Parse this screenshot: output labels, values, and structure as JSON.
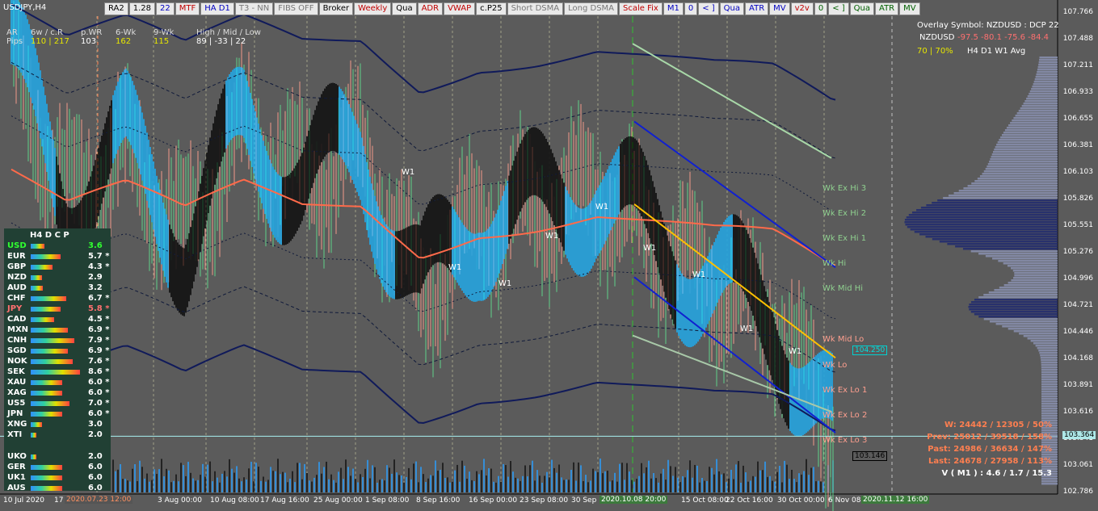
{
  "symbol": "USDJPY,H4",
  "toolbar": [
    "RA2",
    "1.28",
    "22",
    "MTF",
    "HA D1",
    "T3 - NN",
    "FIBS OFF",
    "Broker",
    "Weekly",
    "Qua",
    "ADR",
    "VWAP",
    "c.P25",
    "Short DSMA",
    "Long DSMA",
    "Scale Fix",
    "M1",
    "0",
    "< ]",
    "Qua",
    "ATR",
    "MV",
    "v2v",
    "0",
    "< ]",
    "Qua",
    "ATR",
    "MV"
  ],
  "toolbar_colors": [
    "#000",
    "#000",
    "#0000c0",
    "#c00000",
    "#0000c0",
    "#777",
    "#777",
    "#000",
    "#c00000",
    "#000",
    "#c00000",
    "#c00000",
    "#000",
    "#777",
    "#777",
    "#c00000",
    "#0000c0",
    "#0000c0",
    "#0000c0",
    "#0000c0",
    "#0000c0",
    "#0000c0",
    "#c00000",
    "#006000",
    "#006000",
    "#006000",
    "#006000",
    "#006000"
  ],
  "header": {
    "ar": "AR",
    "pips": "Pips",
    "c1": "6w / c.R",
    "c2": "p.WR",
    "c3": "6-Wk",
    "c4": "9-Wk",
    "c5": "High / Mid / Low",
    "v1": "110 | 217",
    "v2": "103",
    "v3": "162",
    "v4": "115",
    "v5": "89  |  -33  |  22"
  },
  "overlay": {
    "line1": "Overlay Symbol: NZDUSD : DCP 22",
    "sym": "NZDUSD",
    "vals": "-97.5  -80.1  -75.6  -84.4",
    "pct": "70 | 70%",
    "tfs": "H4    D1    W1    Avg"
  },
  "panel": {
    "header": "H4   D C P",
    "rows": [
      {
        "name": "USD",
        "value": "3.6",
        "bar": 0.25,
        "color": "#30ff30"
      },
      {
        "name": "EUR",
        "value": "5.7 *",
        "bar": 0.55,
        "color": "#ffffff"
      },
      {
        "name": "GBP",
        "value": "4.3 *",
        "bar": 0.4,
        "color": "#ffffff"
      },
      {
        "name": "NZD",
        "value": "2.9",
        "bar": 0.2,
        "color": "#ffffff"
      },
      {
        "name": "AUD",
        "value": "3.2",
        "bar": 0.22,
        "color": "#ffffff"
      },
      {
        "name": "CHF",
        "value": "6.7 *",
        "bar": 0.65,
        "color": "#ffffff"
      },
      {
        "name": "JPY",
        "value": "5.8 *",
        "bar": 0.55,
        "color": "#ff7070"
      },
      {
        "name": "CAD",
        "value": "4.5 *",
        "bar": 0.42,
        "color": "#ffffff"
      },
      {
        "name": "MXN",
        "value": "6.9 *",
        "bar": 0.68,
        "color": "#ffffff"
      },
      {
        "name": "CNH",
        "value": "7.9 *",
        "bar": 0.8,
        "color": "#ffffff"
      },
      {
        "name": "SGD",
        "value": "6.9 *",
        "bar": 0.68,
        "color": "#ffffff"
      },
      {
        "name": "NOK",
        "value": "7.6 *",
        "bar": 0.76,
        "color": "#ffffff"
      },
      {
        "name": "SEK",
        "value": "8.6 *",
        "bar": 0.9,
        "color": "#ffffff"
      },
      {
        "name": "XAU",
        "value": "6.0 *",
        "bar": 0.58,
        "color": "#ffffff"
      },
      {
        "name": "XAG",
        "value": "6.0 *",
        "bar": 0.58,
        "color": "#ffffff"
      },
      {
        "name": "US5",
        "value": "7.0 *",
        "bar": 0.7,
        "color": "#ffffff"
      },
      {
        "name": "JPN",
        "value": "6.0 *",
        "bar": 0.58,
        "color": "#ffffff"
      },
      {
        "name": "XNG",
        "value": "3.0",
        "bar": 0.2,
        "color": "#ffffff"
      },
      {
        "name": "XTI",
        "value": "2.0",
        "bar": 0.1,
        "color": "#ffffff"
      },
      {
        "name": "UKO",
        "value": "2.0",
        "bar": 0.1,
        "color": "#ffffff"
      },
      {
        "name": "GER",
        "value": "6.0",
        "bar": 0.58,
        "color": "#ffffff"
      },
      {
        "name": "UK1",
        "value": "6.0",
        "bar": 0.58,
        "color": "#ffffff"
      },
      {
        "name": "AUS",
        "value": "6.0",
        "bar": 0.58,
        "color": "#ffffff"
      }
    ]
  },
  "price_axis": [
    "107.766",
    "107.488",
    "107.211",
    "106.933",
    "106.655",
    "106.381",
    "106.103",
    "105.826",
    "105.551",
    "105.276",
    "104.996",
    "104.721",
    "104.446",
    "104.168",
    "103.891",
    "103.616",
    "103.341",
    "103.061",
    "102.786"
  ],
  "price_tags": {
    "current": "103.364",
    "level": "104.250",
    "low": "103.146"
  },
  "time_axis": [
    "10 Jul 2020",
    "17",
    "3 Aug 00:00",
    "10 Aug 08:00",
    "17 Aug 16:00",
    "25 Aug 00:00",
    "1 Sep 08:00",
    "8 Sep 16:00",
    "16 Sep 00:00",
    "23 Sep 08:00",
    "30 Sep",
    "15 Oct 08:00",
    "22 Oct 16:00",
    "30 Oct 00:00",
    "6 Nov 08"
  ],
  "time_tags": [
    "2020.07.23 12:00",
    "2020.10.08 20:00",
    "2020.11.12 16:00"
  ],
  "levels": [
    "Wk Ex Hi 3",
    "Wk Ex Hi 2",
    "Wk Ex Hi 1",
    "Wk Hi",
    "Wk Mid Hi",
    "Wk Mid Lo",
    "Wk Lo",
    "Wk Ex Lo 1",
    "Wk Ex Lo 2",
    "Wk Ex Lo 3"
  ],
  "w1_label": "W1",
  "stats": {
    "w": "W: 24442 / 12305 / 50%",
    "prev": "Prev: 25012 / 39518 / 158%",
    "past": "Past: 24986 / 36634 / 147%",
    "last": "Last: 24678 / 27958 / 113%",
    "vm1": "V ( M1 ) : 4.6 / 1.7 / 15.3"
  },
  "chart_data": {
    "type": "line",
    "title": "USDJPY,H4",
    "xlabel": "",
    "ylabel": "",
    "ylim": [
      102.786,
      107.766
    ],
    "x": [
      "10 Jul",
      "3 Aug",
      "10 Aug",
      "17 Aug",
      "25 Aug",
      "1 Sep",
      "8 Sep",
      "16 Sep",
      "23 Sep",
      "30 Sep",
      "8 Oct",
      "15 Oct",
      "22 Oct",
      "30 Oct",
      "6 Nov"
    ],
    "series": [
      {
        "name": "",
        "values": [
          107.3,
          105.8,
          106.3,
          105.4,
          106.5,
          106.0,
          106.3,
          104.8,
          105.6,
          105.7,
          105.9,
          105.4,
          104.9,
          104.6,
          103.4
        ]
      }
    ]
  }
}
